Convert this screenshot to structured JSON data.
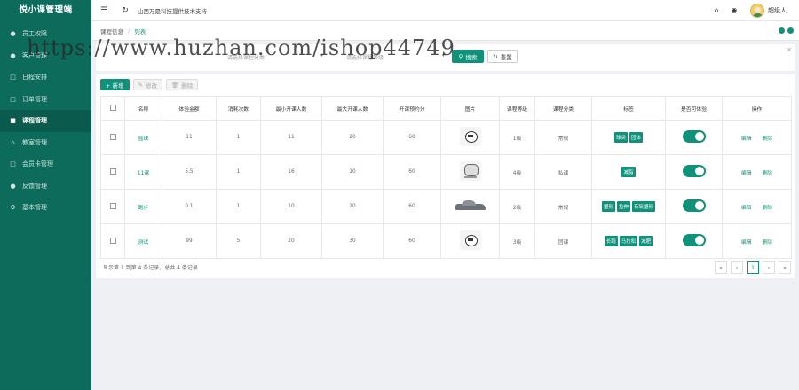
{
  "app_title": "悦小课管理端",
  "sidebar": {
    "items": [
      {
        "label": "员工权限",
        "icon": "user-icon"
      },
      {
        "label": "客户管理",
        "icon": "users-icon"
      },
      {
        "label": "日程安排",
        "icon": "calendar-icon"
      },
      {
        "label": "订单管理",
        "icon": "file-icon"
      },
      {
        "label": "课程管理",
        "icon": "book-icon",
        "active": true
      },
      {
        "label": "教室管理",
        "icon": "home-icon"
      },
      {
        "label": "会员卡管理",
        "icon": "card-icon"
      },
      {
        "label": "反馈管理",
        "icon": "chat-icon"
      },
      {
        "label": "基本管理",
        "icon": "settings-icon"
      }
    ]
  },
  "topbar": {
    "site_text": "山西万是科技提供技术支持",
    "user_name": "超级人"
  },
  "breadcrumb": {
    "parent": "课程信息",
    "current": "列表"
  },
  "search": {
    "field1_placeholder": "请选择课程分类",
    "field2_placeholder": "请选择课程等级",
    "search_label": "搜索",
    "reset_label": "重置"
  },
  "toolbar": {
    "add_label": "+ 新增",
    "edit_label": "修改",
    "delete_label": "删除"
  },
  "table": {
    "headers": [
      "名称",
      "体验金额",
      "消耗次数",
      "最小开课人数",
      "最大开课人数",
      "开课预约分",
      "图片",
      "课程等级",
      "课程分类",
      "标签",
      "是否可体验",
      "操作"
    ],
    "rows": [
      {
        "name": "篮球",
        "price": "11",
        "times": "1",
        "min": "11",
        "max": "20",
        "pre": "60",
        "img": "robot",
        "level": "1级",
        "cat": "常规",
        "tags": [
          "球类",
          "团体"
        ],
        "op": [
          "编辑",
          "删除"
        ]
      },
      {
        "name": "11课",
        "price": "5.5",
        "times": "1",
        "min": "16",
        "max": "10",
        "pre": "60",
        "img": "bot",
        "level": "4级",
        "cat": "私课",
        "tags": [
          "减脂"
        ],
        "op": [
          "编辑",
          "删除"
        ]
      },
      {
        "name": "跑步",
        "price": "0.1",
        "times": "1",
        "min": "10",
        "max": "20",
        "pre": "60",
        "img": "car",
        "level": "2级",
        "cat": "常规",
        "tags": [
          "塑形",
          "拉伸",
          "有氧塑形"
        ],
        "op": [
          "编辑",
          "删除"
        ]
      },
      {
        "name": "测试",
        "price": "99",
        "times": "5",
        "min": "20",
        "max": "30",
        "pre": "60",
        "img": "robot",
        "level": "3级",
        "cat": "团课",
        "tags": [
          "长跑",
          "马拉松",
          "减肥"
        ],
        "op": [
          "编辑",
          "删除"
        ]
      }
    ]
  },
  "footer": {
    "info": "显示第 1 到第 4 条记录，总共 4 条记录",
    "page": "1"
  },
  "watermark": "https://www.huzhan.com/ishop44749",
  "colors": {
    "primary": "#10917a",
    "sidebar": "#0d6b5c"
  }
}
